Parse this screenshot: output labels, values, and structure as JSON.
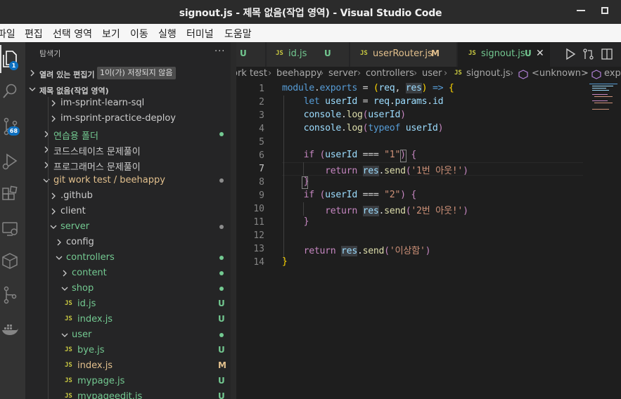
{
  "window": {
    "title": "signout.js - 제목 없음(작업 영역) - Visual Studio Code"
  },
  "menu": [
    "파일",
    "편집",
    "선택 영역",
    "보기",
    "이동",
    "실행",
    "터미널",
    "도움말"
  ],
  "activity": {
    "explorer_badge": "1",
    "scm_badge": "68"
  },
  "sidebar": {
    "title": "탐색기",
    "more": "···",
    "open_editors_label": "열려 있는 편집기",
    "unsaved_badge": "1이(가) 저장되지 않음",
    "workspace_label": "제목 없음(작업 영역)",
    "tree": [
      {
        "name": "im-sprint-learn-sql",
        "type": "folder",
        "open": false,
        "depth": 3,
        "status": ""
      },
      {
        "name": "im-sprint-practice-deploy",
        "type": "folder",
        "open": false,
        "depth": 3,
        "status": ""
      },
      {
        "name": "연습용 폴더",
        "type": "folder",
        "open": false,
        "depth": 2,
        "status": "dot"
      },
      {
        "name": "코드스테이츠 문제풀이",
        "type": "folder",
        "open": false,
        "depth": 2,
        "status": ""
      },
      {
        "name": "프로그래머스 문제풀이",
        "type": "folder",
        "open": false,
        "depth": 2,
        "status": ""
      },
      {
        "name": "git work test / beehappy",
        "type": "folder",
        "open": true,
        "depth": 2,
        "status": "dot"
      },
      {
        "name": ".github",
        "type": "folder",
        "open": false,
        "depth": 3,
        "status": ""
      },
      {
        "name": "client",
        "type": "folder",
        "open": false,
        "depth": 3,
        "status": ""
      },
      {
        "name": "server",
        "type": "folder",
        "open": true,
        "depth": 3,
        "status": "dot"
      },
      {
        "name": "config",
        "type": "folder",
        "open": false,
        "depth": 4,
        "status": ""
      },
      {
        "name": "controllers",
        "type": "folder",
        "open": true,
        "depth": 4,
        "status": "dot"
      },
      {
        "name": "content",
        "type": "folder",
        "open": false,
        "depth": 5,
        "status": "dot"
      },
      {
        "name": "shop",
        "type": "folder",
        "open": true,
        "depth": 5,
        "status": "dot"
      },
      {
        "name": "id.js",
        "type": "js",
        "depth": 5,
        "status": "U"
      },
      {
        "name": "index.js",
        "type": "js",
        "depth": 5,
        "status": "U"
      },
      {
        "name": "user",
        "type": "folder",
        "open": true,
        "depth": 5,
        "status": "dot"
      },
      {
        "name": "bye.js",
        "type": "js",
        "depth": 5,
        "status": "U"
      },
      {
        "name": "index.js",
        "type": "js",
        "depth": 5,
        "status": "M"
      },
      {
        "name": "mypage.js",
        "type": "js",
        "depth": 5,
        "status": "U"
      },
      {
        "name": "mypageedit.js",
        "type": "js",
        "depth": 5,
        "status": "U"
      }
    ]
  },
  "tabs": [
    {
      "label": "",
      "icon": "",
      "status": "U",
      "active": false
    },
    {
      "label": "id.js",
      "icon": "JS",
      "status": "U",
      "active": false
    },
    {
      "label": "userRouter.js",
      "icon": "JS",
      "status": "M",
      "active": false
    },
    {
      "label": "signout.js",
      "icon": "JS",
      "status": "U",
      "active": true
    }
  ],
  "breadcrumb": [
    "ork test",
    "beehappy",
    "server",
    "controllers",
    "user",
    "signout.js",
    "<unknown>",
    "expo"
  ],
  "editor": {
    "current_line": 7,
    "lines": [
      "1",
      "2",
      "3",
      "4",
      "5",
      "6",
      "7",
      "8",
      "9",
      "10",
      "11",
      "12",
      "13",
      "14"
    ]
  },
  "colors": {
    "untracked": "#73c991",
    "modified": "#e2c08d",
    "dot_green": "#73c991",
    "dot_gray": "#8c8c8c",
    "accent": "#0e70c0"
  }
}
